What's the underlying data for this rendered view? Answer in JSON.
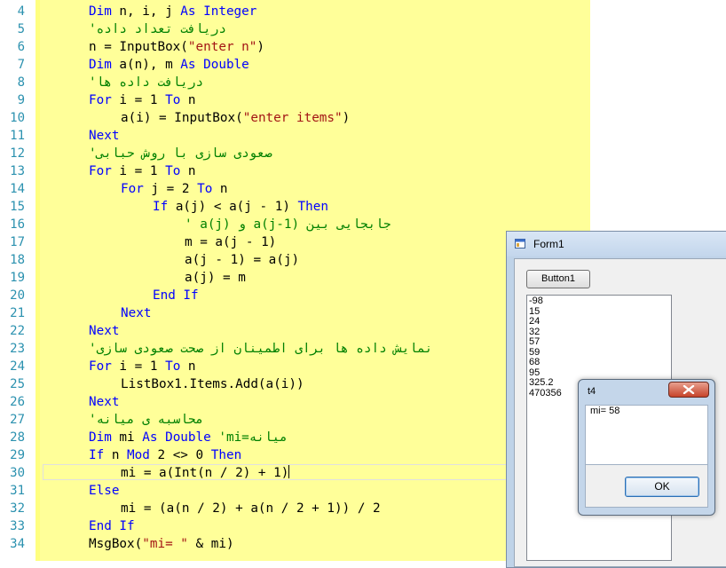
{
  "editor": {
    "lines": [
      {
        "num": "4",
        "indent": 8,
        "parts": [
          {
            "t": "kw",
            "v": "Dim"
          },
          {
            "t": "n",
            "v": " n, i, j "
          },
          {
            "t": "kw",
            "v": "As"
          },
          {
            "t": "n",
            "v": " "
          },
          {
            "t": "kw",
            "v": "Integer"
          }
        ]
      },
      {
        "num": "5",
        "indent": 8,
        "parts": [
          {
            "t": "cm",
            "v": "'دریافت تعداد داده"
          }
        ]
      },
      {
        "num": "6",
        "indent": 8,
        "parts": [
          {
            "t": "n",
            "v": "n = InputBox("
          },
          {
            "t": "str",
            "v": "\"enter n\""
          },
          {
            "t": "n",
            "v": ")"
          }
        ]
      },
      {
        "num": "7",
        "indent": 8,
        "parts": [
          {
            "t": "kw",
            "v": "Dim"
          },
          {
            "t": "n",
            "v": " a(n), m "
          },
          {
            "t": "kw",
            "v": "As"
          },
          {
            "t": "n",
            "v": " "
          },
          {
            "t": "kw",
            "v": "Double"
          }
        ]
      },
      {
        "num": "8",
        "indent": 8,
        "parts": [
          {
            "t": "cm",
            "v": "'دریافت داده ها"
          }
        ]
      },
      {
        "num": "9",
        "indent": 8,
        "parts": [
          {
            "t": "kw",
            "v": "For"
          },
          {
            "t": "n",
            "v": " i = 1 "
          },
          {
            "t": "kw",
            "v": "To"
          },
          {
            "t": "n",
            "v": " n"
          }
        ]
      },
      {
        "num": "10",
        "indent": 12,
        "parts": [
          {
            "t": "n",
            "v": "a(i) = InputBox("
          },
          {
            "t": "str",
            "v": "\"enter items\""
          },
          {
            "t": "n",
            "v": ")"
          }
        ]
      },
      {
        "num": "11",
        "indent": 8,
        "parts": [
          {
            "t": "kw",
            "v": "Next"
          }
        ]
      },
      {
        "num": "12",
        "indent": 8,
        "parts": [
          {
            "t": "cm",
            "v": "'صعودی سازی با روش حبابی"
          }
        ]
      },
      {
        "num": "13",
        "indent": 8,
        "parts": [
          {
            "t": "kw",
            "v": "For"
          },
          {
            "t": "n",
            "v": " i = 1 "
          },
          {
            "t": "kw",
            "v": "To"
          },
          {
            "t": "n",
            "v": " n"
          }
        ]
      },
      {
        "num": "14",
        "indent": 12,
        "parts": [
          {
            "t": "kw",
            "v": "For"
          },
          {
            "t": "n",
            "v": " j = 2 "
          },
          {
            "t": "kw",
            "v": "To"
          },
          {
            "t": "n",
            "v": " n"
          }
        ]
      },
      {
        "num": "15",
        "indent": 16,
        "parts": [
          {
            "t": "kw",
            "v": "If"
          },
          {
            "t": "n",
            "v": " a(j) < a(j - 1) "
          },
          {
            "t": "kw",
            "v": "Then"
          }
        ]
      },
      {
        "num": "16",
        "indent": 20,
        "parts": [
          {
            "t": "cm",
            "v": "' a(j) و a(j-1) جابجایی بین"
          }
        ]
      },
      {
        "num": "17",
        "indent": 20,
        "parts": [
          {
            "t": "n",
            "v": "m = a(j - 1)"
          }
        ]
      },
      {
        "num": "18",
        "indent": 20,
        "parts": [
          {
            "t": "n",
            "v": "a(j - 1) = a(j)"
          }
        ]
      },
      {
        "num": "19",
        "indent": 20,
        "parts": [
          {
            "t": "n",
            "v": "a(j) = m"
          }
        ]
      },
      {
        "num": "20",
        "indent": 16,
        "parts": [
          {
            "t": "kw",
            "v": "End If"
          }
        ]
      },
      {
        "num": "21",
        "indent": 12,
        "parts": [
          {
            "t": "kw",
            "v": "Next"
          }
        ]
      },
      {
        "num": "22",
        "indent": 8,
        "parts": [
          {
            "t": "kw",
            "v": "Next"
          }
        ]
      },
      {
        "num": "23",
        "indent": 8,
        "parts": [
          {
            "t": "cm",
            "v": "'نمایش داده ها برای اطمینان از صحت صعودی سازی"
          }
        ]
      },
      {
        "num": "24",
        "indent": 8,
        "parts": [
          {
            "t": "kw",
            "v": "For"
          },
          {
            "t": "n",
            "v": " i = 1 "
          },
          {
            "t": "kw",
            "v": "To"
          },
          {
            "t": "n",
            "v": " n"
          }
        ]
      },
      {
        "num": "25",
        "indent": 12,
        "parts": [
          {
            "t": "n",
            "v": "ListBox1.Items.Add(a(i))"
          }
        ]
      },
      {
        "num": "26",
        "indent": 8,
        "parts": [
          {
            "t": "kw",
            "v": "Next"
          }
        ]
      },
      {
        "num": "27",
        "indent": 8,
        "parts": [
          {
            "t": "cm",
            "v": "'محاسبه ی میانه"
          }
        ]
      },
      {
        "num": "28",
        "indent": 8,
        "parts": [
          {
            "t": "kw",
            "v": "Dim"
          },
          {
            "t": "n",
            "v": " mi "
          },
          {
            "t": "kw",
            "v": "As"
          },
          {
            "t": "n",
            "v": " "
          },
          {
            "t": "kw",
            "v": "Double"
          },
          {
            "t": "n",
            "v": " "
          },
          {
            "t": "cm",
            "v": "'mi=میانه"
          }
        ]
      },
      {
        "num": "29",
        "indent": 8,
        "parts": [
          {
            "t": "kw",
            "v": "If"
          },
          {
            "t": "n",
            "v": " n "
          },
          {
            "t": "kw",
            "v": "Mod"
          },
          {
            "t": "n",
            "v": " 2 <> 0 "
          },
          {
            "t": "kw",
            "v": "Then"
          }
        ]
      },
      {
        "num": "30",
        "indent": 12,
        "parts": [
          {
            "t": "n",
            "v": "mi = a(Int(n / 2) + 1)"
          }
        ],
        "current": true
      },
      {
        "num": "31",
        "indent": 8,
        "parts": [
          {
            "t": "kw",
            "v": "Else"
          }
        ]
      },
      {
        "num": "32",
        "indent": 12,
        "parts": [
          {
            "t": "n",
            "v": "mi = (a(n / 2) + a(n / 2 + 1)) / 2"
          }
        ]
      },
      {
        "num": "33",
        "indent": 8,
        "parts": [
          {
            "t": "kw",
            "v": "End If"
          }
        ]
      },
      {
        "num": "34",
        "indent": 8,
        "parts": [
          {
            "t": "n",
            "v": "MsgBox("
          },
          {
            "t": "str",
            "v": "\"mi= \""
          },
          {
            "t": "n",
            "v": " & mi)"
          }
        ]
      }
    ]
  },
  "form1": {
    "title": "Form1",
    "icon": "window-app-icon",
    "button1_label": "Button1",
    "listbox_items": [
      "-98",
      "15",
      "24",
      "32",
      "57",
      "59",
      "68",
      "95",
      "325.2",
      "470356"
    ]
  },
  "msgbox": {
    "title": "t4",
    "message": "mi= 58",
    "ok_label": "OK",
    "close_icon": "close-icon"
  }
}
